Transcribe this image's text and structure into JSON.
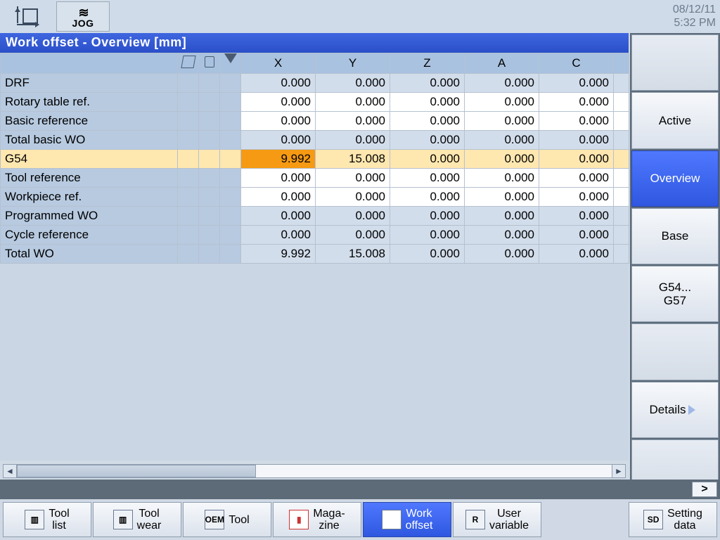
{
  "datetime": {
    "date": "08/12/11",
    "time": "5:32 PM"
  },
  "top_icons": {
    "jog_label": "JOG"
  },
  "title": "Work offset - Overview [mm]",
  "columns": {
    "axis": [
      "X",
      "Y",
      "Z",
      "A",
      "C"
    ]
  },
  "rows": [
    {
      "name": "DRF",
      "style": "alt",
      "vals": [
        "0.000",
        "0.000",
        "0.000",
        "0.000",
        "0.000"
      ]
    },
    {
      "name": "Rotary table ref.",
      "style": "plain",
      "vals": [
        "0.000",
        "0.000",
        "0.000",
        "0.000",
        "0.000"
      ]
    },
    {
      "name": "Basic reference",
      "style": "plain",
      "vals": [
        "0.000",
        "0.000",
        "0.000",
        "0.000",
        "0.000"
      ]
    },
    {
      "name": "Total basic WO",
      "style": "alt",
      "vals": [
        "0.000",
        "0.000",
        "0.000",
        "0.000",
        "0.000"
      ]
    },
    {
      "name": "G54",
      "style": "g54",
      "vals": [
        "9.992",
        "15.008",
        "0.000",
        "0.000",
        "0.000"
      ],
      "active_col": 0
    },
    {
      "name": "Tool reference",
      "style": "plain",
      "vals": [
        "0.000",
        "0.000",
        "0.000",
        "0.000",
        "0.000"
      ]
    },
    {
      "name": "Workpiece ref.",
      "style": "plain",
      "vals": [
        "0.000",
        "0.000",
        "0.000",
        "0.000",
        "0.000"
      ]
    },
    {
      "name": "Programmed WO",
      "style": "alt",
      "vals": [
        "0.000",
        "0.000",
        "0.000",
        "0.000",
        "0.000"
      ]
    },
    {
      "name": "Cycle reference",
      "style": "alt",
      "vals": [
        "0.000",
        "0.000",
        "0.000",
        "0.000",
        "0.000"
      ]
    },
    {
      "name": "Total WO",
      "style": "alt",
      "vals": [
        "9.992",
        "15.008",
        "0.000",
        "0.000",
        "0.000"
      ]
    }
  ],
  "right_softkeys": [
    {
      "label": "",
      "blank": true
    },
    {
      "label": "Active"
    },
    {
      "label": "Overview",
      "active": true
    },
    {
      "label": "Base"
    },
    {
      "label": "G54...\nG57"
    },
    {
      "label": "",
      "blank": true
    },
    {
      "label": "Details",
      "arrow": true
    },
    {
      "label": "",
      "blank": true
    }
  ],
  "bottom_softkeys": {
    "tool_list": {
      "label": "Tool\nlist",
      "icon": ""
    },
    "tool_wear": {
      "label": "Tool\nwear",
      "icon": ""
    },
    "oem_tool": {
      "label": "Tool",
      "icon": "OEM"
    },
    "magazine": {
      "label": "Maga-\nzine",
      "icon": ""
    },
    "work_offset": {
      "label": "Work\noffset",
      "icon": "",
      "active": true
    },
    "user_var": {
      "label": "User\nvariable",
      "icon": "R"
    },
    "setting": {
      "label": "Setting\ndata",
      "icon": "SD"
    }
  },
  "more_chip": ">"
}
